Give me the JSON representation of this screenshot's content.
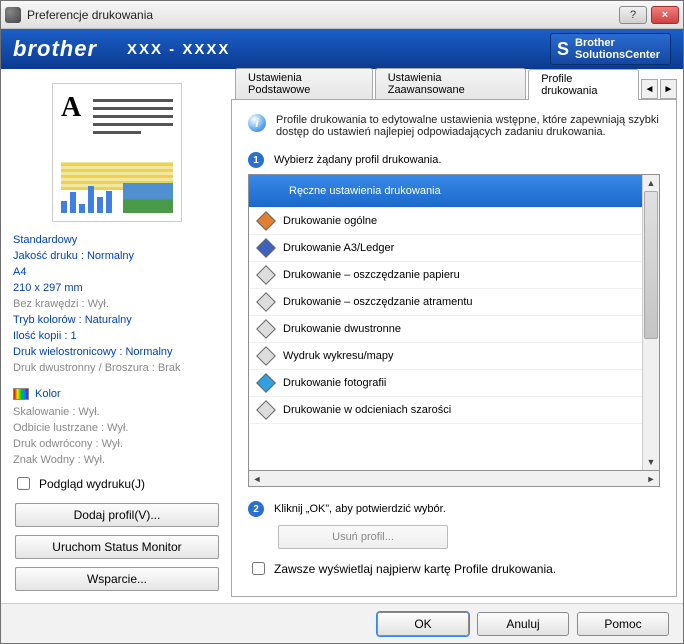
{
  "window": {
    "title": "Preferencje drukowania",
    "help": "?",
    "close": "×"
  },
  "brand": {
    "logo": "brother",
    "model": "XXX - XXXX",
    "sc_line1": "Brother",
    "sc_line2": "SolutionsCenter"
  },
  "left": {
    "props": {
      "l1": "Standardowy",
      "l2": "Jakość druku : Normalny",
      "l3": "A4",
      "l4": "210 x 297 mm",
      "l5": "Bez krawędzi : Wył.",
      "l6": "Tryb kolorów : Naturalny",
      "l7": "Ilość kopii : 1",
      "l8": "Druk wielostronicowy  : Normalny",
      "l9": "Druk dwustronny / Broszura : Brak"
    },
    "color_label": "Kolor",
    "ext": {
      "e1": "Skalowanie : Wył.",
      "e2": "Odbicie lustrzane  : Wył.",
      "e3": "Druk odwrócony  : Wył.",
      "e4": "Znak Wodny : Wył."
    },
    "preview_chk": "Podgląd wydruku(J)",
    "btn_add": "Dodaj profil(V)...",
    "btn_monitor": "Uruchom Status Monitor",
    "btn_support": "Wsparcie..."
  },
  "tabs": {
    "t1": "Ustawienia Podstawowe",
    "t2": "Ustawienia Zaawansowane",
    "t3": "Profile drukowania"
  },
  "info": "Profile drukowania to edytowalne ustawienia wstępne, które zapewniają szybki dostęp do ustawień najlepiej odpowiadających zadaniu drukowania.",
  "step1": "Wybierz żądany profil drukowania.",
  "profiles": [
    {
      "label": "Ręczne ustawienia drukowania",
      "selected": true
    },
    {
      "label": "Drukowanie ogólne"
    },
    {
      "label": "Drukowanie A3/Ledger"
    },
    {
      "label": "Drukowanie – oszczędzanie papieru"
    },
    {
      "label": "Drukowanie – oszczędzanie atramentu"
    },
    {
      "label": "Drukowanie dwustronne"
    },
    {
      "label": "Wydruk wykresu/mapy"
    },
    {
      "label": "Drukowanie fotografii"
    },
    {
      "label": "Drukowanie w odcieniach szarości"
    }
  ],
  "step2": "Kliknij „OK”, aby potwierdzić wybór.",
  "btn_delete": "Usuń profil...",
  "always_chk": "Zawsze wyświetlaj najpierw kartę Profile drukowania.",
  "footer": {
    "ok": "OK",
    "cancel": "Anuluj",
    "help": "Pomoc"
  }
}
